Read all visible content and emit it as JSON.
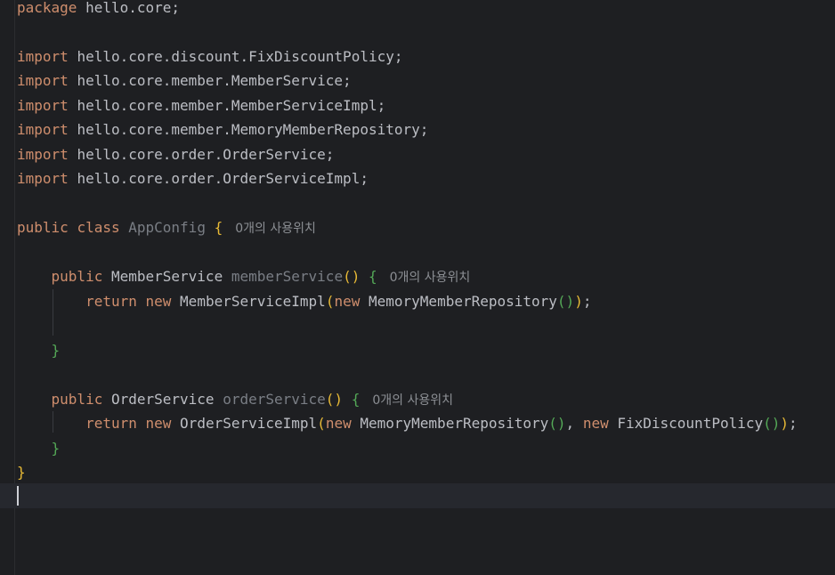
{
  "code": {
    "package_kw": "package",
    "package_name": "hello.core;",
    "imports": [
      {
        "kw": "import",
        "path": "hello.core.discount.FixDiscountPolicy;"
      },
      {
        "kw": "import",
        "path": "hello.core.member.MemberService;"
      },
      {
        "kw": "import",
        "path": "hello.core.member.MemberServiceImpl;"
      },
      {
        "kw": "import",
        "path": "hello.core.member.MemoryMemberRepository;"
      },
      {
        "kw": "import",
        "path": "hello.core.order.OrderService;"
      },
      {
        "kw": "import",
        "path": "hello.core.order.OrderServiceImpl;"
      }
    ],
    "class_decl": {
      "public_kw": "public",
      "class_kw": "class",
      "name": "AppConfig",
      "open_brace": "{",
      "usages": "0개의 사용위치"
    },
    "method1": {
      "public_kw": "public",
      "return_type": "MemberService",
      "name": "memberService",
      "parens": "()",
      "open_brace": "{",
      "usages": "0개의 사용위치",
      "return_kw": "return",
      "new_kw": "new",
      "impl": "MemberServiceImpl",
      "open_paren": "(",
      "new_kw2": "new",
      "repo": "MemoryMemberRepository",
      "inner_parens": "()",
      "close_paren": ")",
      "semicolon": ";",
      "close_brace": "}"
    },
    "method2": {
      "public_kw": "public",
      "return_type": "OrderService",
      "name": "orderService",
      "parens": "()",
      "open_brace": "{",
      "usages": "0개의 사용위치",
      "return_kw": "return",
      "new_kw": "new",
      "impl": "OrderServiceImpl",
      "open_paren": "(",
      "new_kw2": "new",
      "repo": "MemoryMemberRepository",
      "inner_parens": "()",
      "comma": ", ",
      "new_kw3": "new",
      "policy": "FixDiscountPolicy",
      "inner_parens2": "()",
      "close_paren": ")",
      "semicolon": ";",
      "close_brace": "}"
    },
    "class_close_brace": "}"
  },
  "colors": {
    "background": "#1e1f22",
    "keyword": "#cf8e6d",
    "text": "#bcbec4",
    "unused": "#7a7e85",
    "brace_yellow": "#e8ba36",
    "brace_green": "#54a857"
  }
}
